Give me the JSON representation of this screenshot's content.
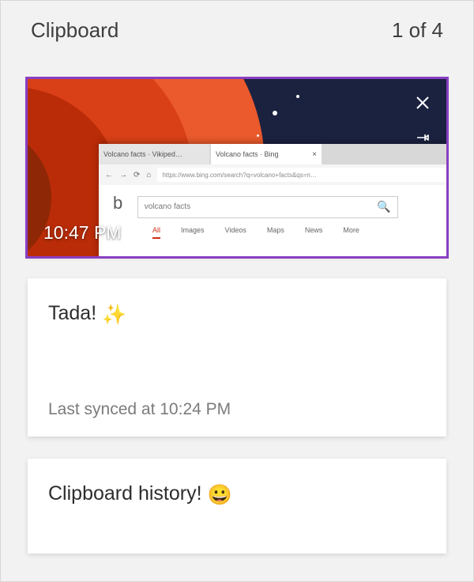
{
  "header": {
    "title": "Clipboard",
    "counter": "1 of 4"
  },
  "items": [
    {
      "type": "image",
      "selected": true,
      "timestamp": "10:47 PM"
    },
    {
      "type": "text",
      "text": "Tada!",
      "emoji": "✨",
      "sync_text": "Last synced at 10:24 PM"
    },
    {
      "type": "text",
      "text": "Clipboard history!",
      "emoji": "😀"
    }
  ],
  "thumb": {
    "tab1": "Volcano facts · Vikiped…",
    "tab2": "Volcano facts · Bing",
    "url": "https://www.bing.com/search?q=volcano+facts&qs=n…",
    "search_text": "volcano facts",
    "nav": [
      "All",
      "Images",
      "Videos",
      "Maps",
      "News",
      "More"
    ]
  },
  "colors": {
    "selection": "#8a3fc2",
    "panel_bg": "#f2f2f2"
  }
}
